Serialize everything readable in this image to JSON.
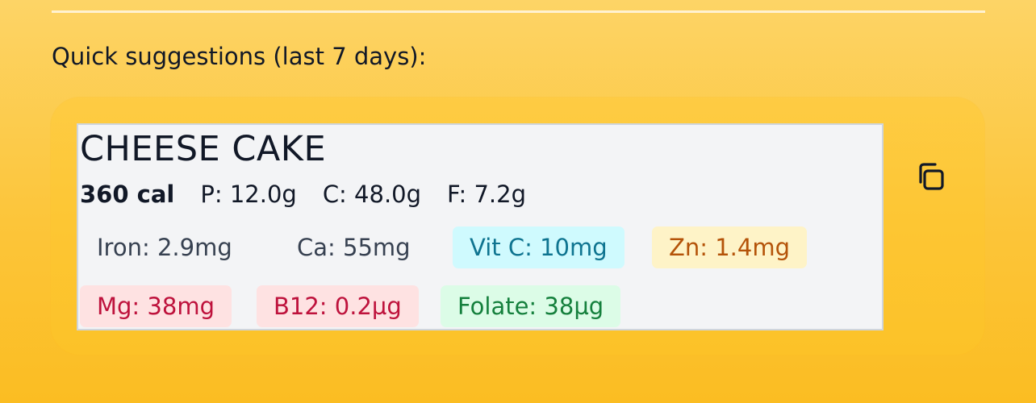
{
  "section_title": "Quick suggestions (last 7 days):",
  "suggestion": {
    "name": "CHEESE CAKE",
    "calories": "360 cal",
    "protein": "P: 12.0g",
    "carbs": "C: 48.0g",
    "fat": "F: 7.2g",
    "nutrients": {
      "iron": "Iron: 2.9mg",
      "calcium": "Ca: 55mg",
      "vit_c": "Vit C: 10mg",
      "zinc": "Zn: 1.4mg",
      "magnesium": "Mg: 38mg",
      "b12": "B12: 0.2µg",
      "folate": "Folate: 38µg"
    },
    "copy_icon": "copy-icon"
  },
  "colors": {
    "background_top": "#fdd466",
    "background_bottom": "#fbbd22",
    "vit_c_bg": "#cffafe",
    "zinc_bg": "#fef3c7",
    "mineral_bg": "#fee2e2",
    "folate_bg": "#dcfce7"
  }
}
